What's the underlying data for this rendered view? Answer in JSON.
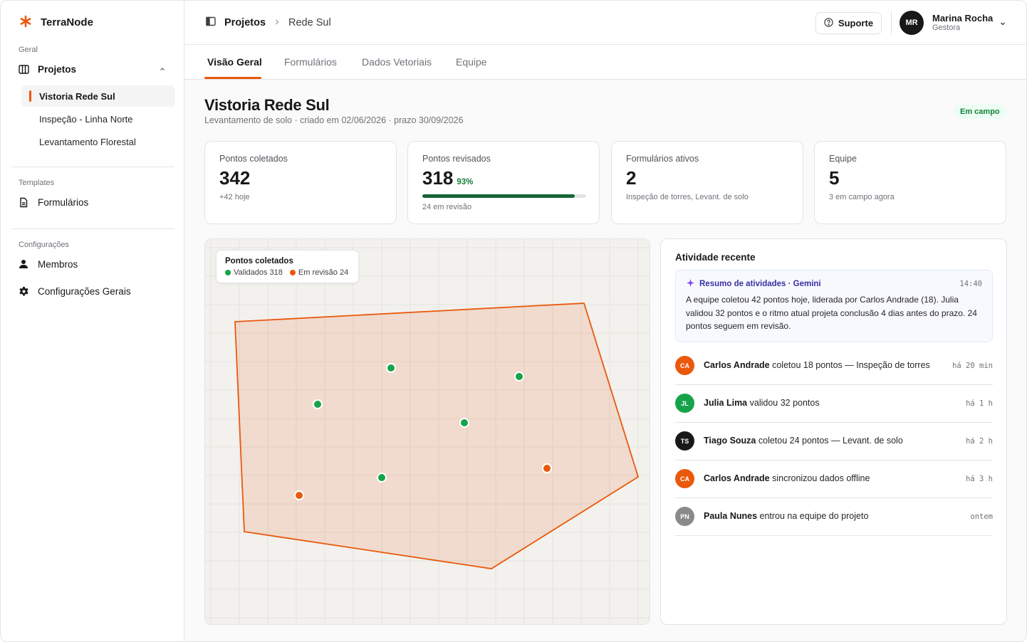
{
  "brand": {
    "name": "TerraNode",
    "accent": "#ea580c"
  },
  "sidebar": {
    "section_geral": "Geral",
    "projetos_label": "Projetos",
    "projects": [
      {
        "label": "Vistoria Rede Sul",
        "active": true
      },
      {
        "label": "Inspeção - Linha Norte"
      },
      {
        "label": "Levantamento Florestal"
      }
    ],
    "section_templates": "Templates",
    "formularios_label": "Formulários",
    "section_config": "Configurações",
    "membros_label": "Membros",
    "config_gerais_label": "Configurações Gerais"
  },
  "topbar": {
    "crumb_main": "Projetos",
    "crumb_sub": "Rede Sul",
    "support_label": "Suporte",
    "user": {
      "initials": "MR",
      "name": "Marina Rocha",
      "role": "Gestora"
    }
  },
  "tabs": [
    "Visão Geral",
    "Formulários",
    "Dados Vetoriais",
    "Equipe"
  ],
  "project": {
    "title": "Vistoria Rede Sul",
    "subtitle": "Levantamento de solo · criado em 02/06/2026 · prazo 30/09/2026",
    "status": "Em campo"
  },
  "stats": {
    "coletados": {
      "label": "Pontos coletados",
      "value": "342",
      "note": "+42 hoje"
    },
    "revisados": {
      "label": "Pontos revisados",
      "value": "318",
      "pct": "93%",
      "progress": 0.93,
      "note": "24 em revisão"
    },
    "formularios": {
      "label": "Formulários ativos",
      "value": "2",
      "note": "Inspeção de torres, Levant. de solo"
    },
    "equipe": {
      "label": "Equipe",
      "value": "5",
      "note": "3 em campo agora"
    }
  },
  "map": {
    "legend_title": "Pontos coletados",
    "validated_label": "Validados 318",
    "review_label": "Em revisão 24",
    "validated_color": "#16a34a",
    "review_color": "#ea580c"
  },
  "activity": {
    "title": "Atividade recente",
    "summary": {
      "title": "Resumo de atividades · Gemini",
      "time": "14:40",
      "text": "A equipe coletou 42 pontos hoje, liderada por Carlos Andrade (18). Julia validou 32 pontos e o ritmo atual projeta conclusão 4 dias antes do prazo. 24 pontos seguem em revisão."
    },
    "items": [
      {
        "initials": "CA",
        "name": "Carlos Andrade",
        "text": " coletou 18 pontos — Inspeção de torres",
        "time": "há 20 min",
        "color": "#ea580c"
      },
      {
        "initials": "JL",
        "name": "Julia Lima",
        "text": " validou 32 pontos",
        "time": "há 1 h",
        "color": "#16a34a"
      },
      {
        "initials": "TS",
        "name": "Tiago Souza",
        "text": " coletou 24 pontos — Levant. de solo",
        "time": "há 2 h",
        "color": "#18181b"
      },
      {
        "initials": "CA",
        "name": "Carlos Andrade",
        "text": " sincronizou dados offline",
        "time": "há 3 h",
        "color": "#ea580c"
      },
      {
        "initials": "PN",
        "name": "Paula Nunes",
        "text": " entrou na equipe do projeto",
        "time": "ontem",
        "color": "#8a8a8a"
      }
    ]
  }
}
